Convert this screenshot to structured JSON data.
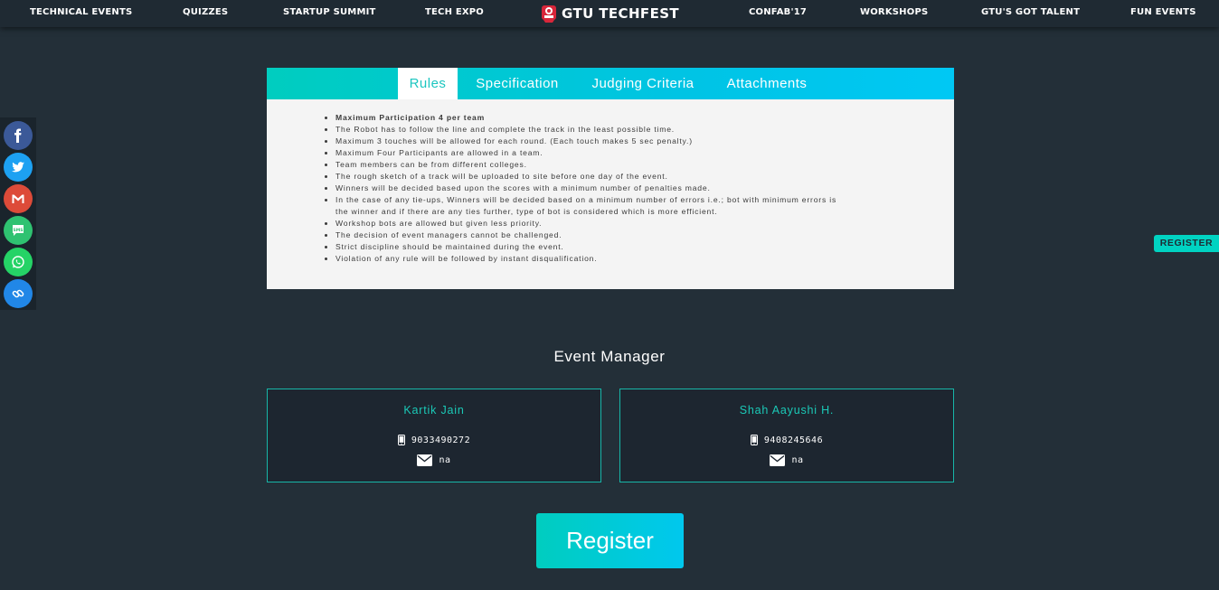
{
  "nav": {
    "items": [
      "TECHNICAL EVENTS",
      "QUIZZES",
      "STARTUP SUMMIT",
      "TECH EXPO",
      "CONFAB'17",
      "WORKSHOPS",
      "GTU'S GOT TALENT",
      "FUN EVENTS"
    ],
    "brand": "GTU TECHFEST"
  },
  "social": [
    {
      "icon": "facebook-icon",
      "color": "#3b5998"
    },
    {
      "icon": "twitter-icon",
      "color": "#1da1f2"
    },
    {
      "icon": "gmail-icon",
      "color": "#dd4b39"
    },
    {
      "icon": "sms-icon",
      "color": "#2fc271"
    },
    {
      "icon": "whatsapp-icon",
      "color": "#25d366"
    },
    {
      "icon": "link-icon",
      "color": "#2187e7"
    }
  ],
  "tabs": [
    "Rules",
    "Specification",
    "Judging Criteria",
    "Attachments"
  ],
  "active_tab": "Rules",
  "rules": [
    "Maximum Participation 4 per team",
    "The Robot has to follow the line and complete the track in the least possible time.",
    "Maximum 3 touches will be allowed for each round. (Each touch makes 5 sec penalty.)",
    "Maximum Four Participants are allowed in a team.",
    "Team members can be from different colleges.",
    "The rough sketch of a track will be uploaded to site before one day of the event.",
    "Winners will be decided based upon the scores with a minimum number of penalties made.",
    "In the case of any tie-ups, Winners will be decided based on a minimum number of errors i.e.; bot with minimum errors is the winner and if there are any ties further, type of bot is considered which is more efficient.",
    "Workshop bots are allowed but given less priority.",
    "The decision of event managers cannot be challenged.",
    "Strict discipline should be maintained during the event.",
    "Violation of any rule will be followed by instant disqualification."
  ],
  "side_register": "REGISTER",
  "event_manager": {
    "title": "Event Manager",
    "managers": [
      {
        "name": "Kartik Jain",
        "phone": "9033490272",
        "email": "na"
      },
      {
        "name": "Shah Aayushi H.",
        "phone": "9408245646",
        "email": "na"
      }
    ]
  },
  "register_button": "Register",
  "colors": {
    "background": "#232f38",
    "accent": "#00cdbf",
    "accent_blue": "#00c8f4",
    "nav_bg": "#1f2a33"
  }
}
